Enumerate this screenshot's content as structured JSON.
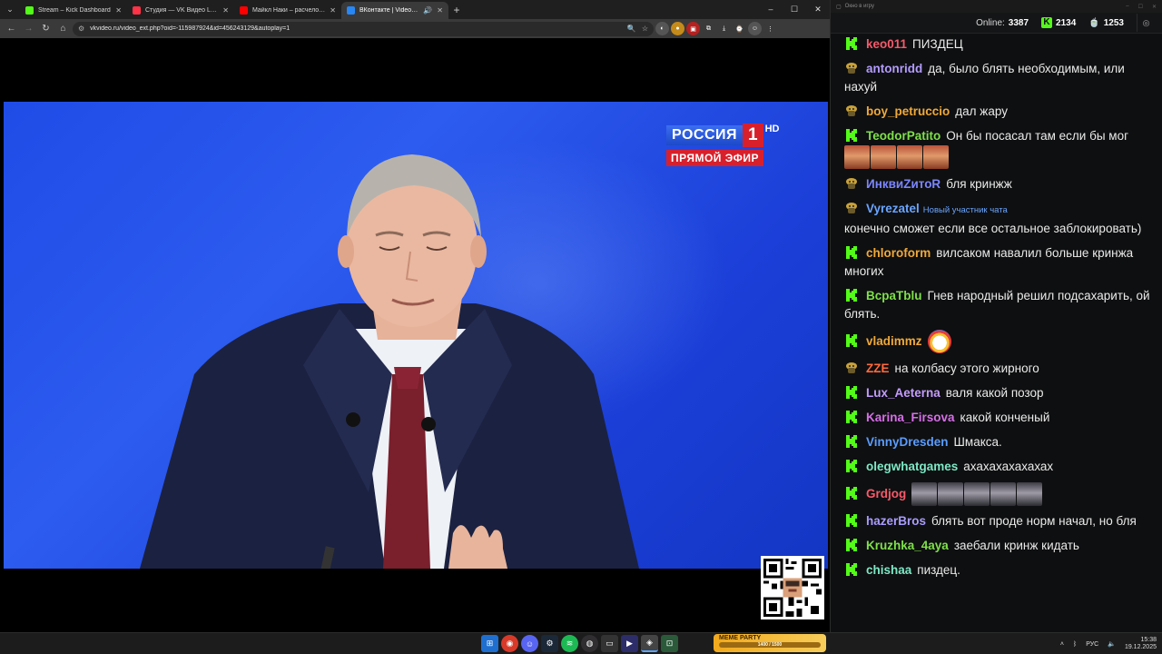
{
  "browser": {
    "tabs": [
      {
        "title": "Stream – Kick Dashboard",
        "color": "#53fc18",
        "active": false
      },
      {
        "title": "Студия — VK Видео Live",
        "color": "#ff3347",
        "active": false
      },
      {
        "title": "Майкл Наки – расчеловечива",
        "color": "#ff0000",
        "active": false
      },
      {
        "title": "ВКонтакте | Video Ext",
        "color": "#2787f5",
        "active": true
      }
    ],
    "url": "vkvideo.ru/video_ext.php?oid=-115987924&id=456243129&autoplay=1"
  },
  "video": {
    "channel_logo": "РОССИЯ",
    "channel_number": "1",
    "hd_label": "HD",
    "live_label": "ПРЯМОЙ ЭФИР"
  },
  "chat": {
    "window_title": "Окно в игру",
    "online_label": "Online:",
    "online_count": "3387",
    "kick_count": "2134",
    "twitch_count": "1253",
    "messages": [
      {
        "badge": "kick",
        "user": "keo011",
        "color": "#f65a6b",
        "text": "ПИЗДЕЦ"
      },
      {
        "badge": "twitch",
        "user": "antonridd",
        "color": "#b49cff",
        "text": "да, было блять необходимым, или нахуй"
      },
      {
        "badge": "twitch",
        "user": "boy_petruccio",
        "color": "#f0a93a",
        "text": "дал жару"
      },
      {
        "badge": "kick",
        "user": "TeodorPatito",
        "color": "#7ee04a",
        "text": "Он бы посасал там если бы мог"
      },
      {
        "badge": "twitch",
        "user": "ИнквиZитоR",
        "color": "#7c86ff",
        "text": "бля кринжж"
      },
      {
        "badge": "twitch",
        "user": "Vyrezatel",
        "color": "#6aa5ff",
        "tag": "Новый участник чата",
        "text": "конечно сможет если все остальное заблокировать)"
      },
      {
        "badge": "kick",
        "user": "chloroform",
        "color": "#f0a93a",
        "text": "вилсаком навалил больше кринжа многих"
      },
      {
        "badge": "kick",
        "user": "BcpaTblu",
        "color": "#7ee04a",
        "text": "Гнев народный решил подсахарить, ой блять."
      },
      {
        "badge": "kick",
        "user": "vladimmz",
        "color": "#f0a93a",
        "text": ""
      },
      {
        "badge": "twitch",
        "user": "ZZE",
        "color": "#ff6a3d",
        "text": "на колбасу этого жирного"
      },
      {
        "badge": "kick",
        "user": "Lux_Aeterna",
        "color": "#c49cff",
        "text": "валя какой позор"
      },
      {
        "badge": "kick",
        "user": "Karina_Firsova",
        "color": "#d66fe8",
        "text": "какой конченый"
      },
      {
        "badge": "kick",
        "user": "VinnyDresden",
        "color": "#5b9dff",
        "text": "Шмакса."
      },
      {
        "badge": "kick",
        "user": "olegwhatgames",
        "color": "#7fe8c6",
        "text": "ахахахахахахах"
      },
      {
        "badge": "kick",
        "user": "Grdjog",
        "color": "#f65a6b",
        "text": ""
      },
      {
        "badge": "kick",
        "user": "hazerBros",
        "color": "#a99cff",
        "text": "блять вот проде норм начал, но бля"
      },
      {
        "badge": "kick",
        "user": "Kruzhka_4aya",
        "color": "#7ee04a",
        "text": "заебали кринж кидать"
      },
      {
        "badge": "kick",
        "user": "chishaa",
        "color": "#7fe8c6",
        "text": "пиздец."
      }
    ]
  },
  "taskbar": {
    "meme_title": "MEME PARTY",
    "meme_progress": "1400 / 1500",
    "lang": "РУС",
    "time": "15:38",
    "date": "19.12.2025"
  }
}
